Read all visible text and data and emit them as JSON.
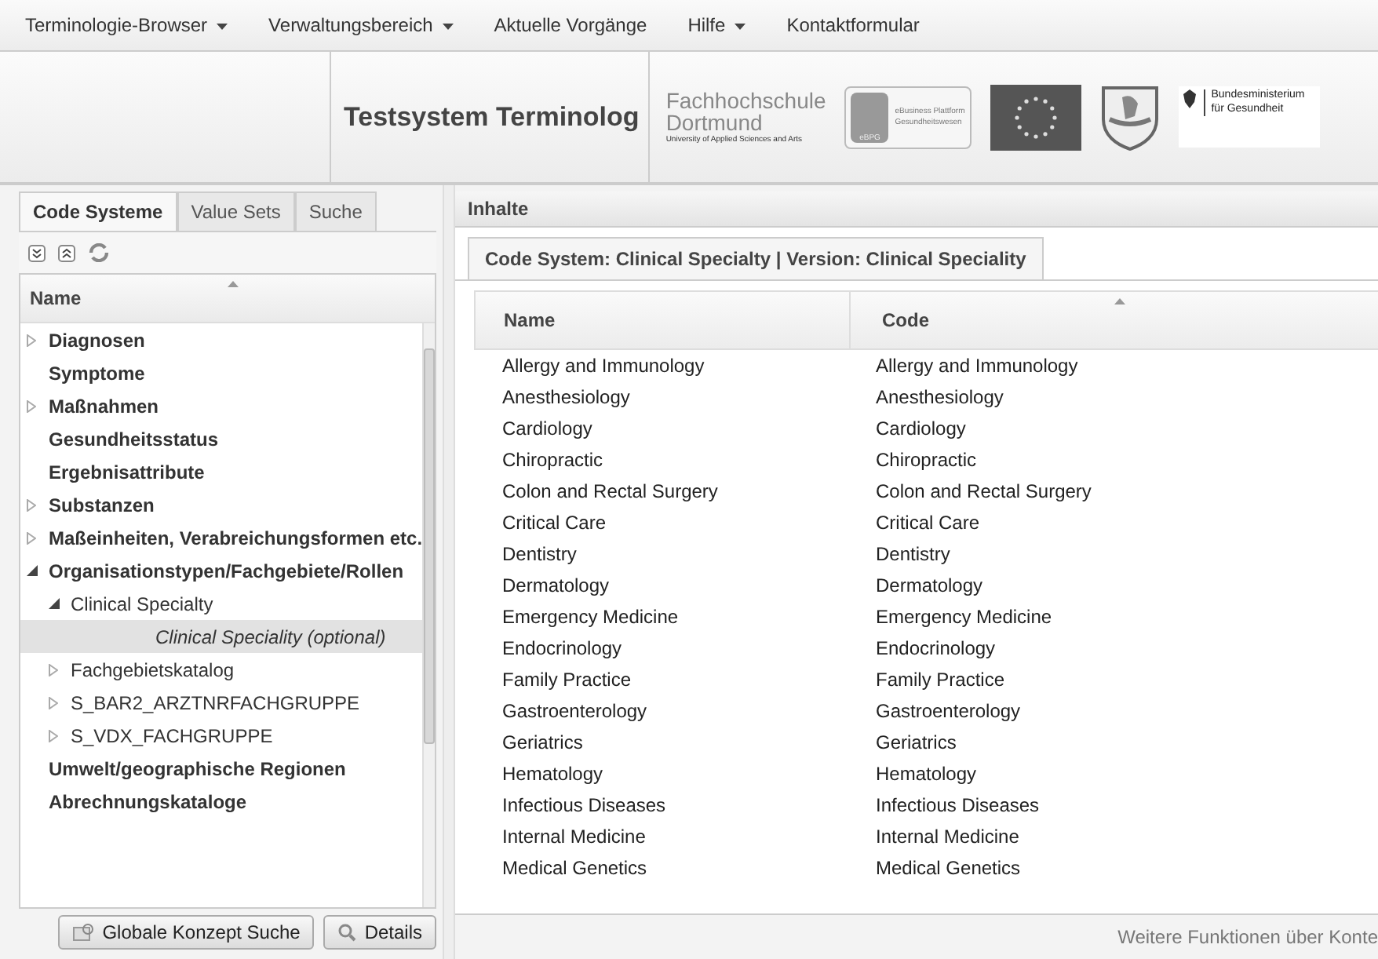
{
  "menu": [
    {
      "label": "Terminologie-Browser",
      "dropdown": true
    },
    {
      "label": "Verwaltungsbereich",
      "dropdown": true
    },
    {
      "label": "Aktuelle Vorgänge",
      "dropdown": false
    },
    {
      "label": "Hilfe",
      "dropdown": true
    },
    {
      "label": "Kontaktformular",
      "dropdown": false
    }
  ],
  "header": {
    "title": "Testsystem Terminolog",
    "fh_logo": [
      "Fachhochschule",
      "Dortmund",
      "University of Applied Sciences and Arts"
    ],
    "ebpg_logo": [
      "eBusiness Plattform",
      "Gesundheitswesen",
      "eBPG"
    ],
    "bmg_logo": [
      "Bundesministerium",
      "für Gesundheit"
    ]
  },
  "left_tabs": [
    {
      "label": "Code Systeme",
      "selected": true
    },
    {
      "label": "Value Sets",
      "selected": false
    },
    {
      "label": "Suche",
      "selected": false
    }
  ],
  "tree": {
    "column": "Name",
    "items": [
      {
        "label": "Diagnosen",
        "expanded": false,
        "selected": false
      },
      {
        "label": "Symptome",
        "selected": false
      },
      {
        "label": "Maßnahmen",
        "expanded": false,
        "selected": false
      },
      {
        "label": "Gesundheitsstatus",
        "selected": false
      },
      {
        "label": "Ergebnisattribute",
        "selected": false
      },
      {
        "label": "Substanzen",
        "expanded": false,
        "selected": false
      },
      {
        "label": "Maßeinheiten, Verabreichungsformen etc.",
        "expanded": false,
        "selected": false
      },
      {
        "label": "Organisationstypen/Fachgebiete/Rollen",
        "expanded": true,
        "selected": false,
        "children": [
          {
            "label": "Clinical Specialty",
            "expanded": true,
            "selected": false,
            "children": [
              {
                "label": "Clinical Speciality (optional)",
                "selected": true,
                "italic": true
              }
            ]
          },
          {
            "label": "Fachgebietskatalog",
            "expanded": false,
            "selected": false
          },
          {
            "label": "S_BAR2_ARZTNRFACHGRUPPE",
            "expanded": false,
            "selected": false
          },
          {
            "label": "S_VDX_FACHGRUPPE",
            "expanded": false,
            "selected": false
          }
        ]
      },
      {
        "label": "Umwelt/geographische Regionen",
        "selected": false
      },
      {
        "label": "Abrechnungskataloge",
        "selected": false
      }
    ]
  },
  "left_buttons": [
    "Globale Konzept Suche",
    "Details"
  ],
  "content": {
    "title": "Inhalte",
    "tab": "Code System: Clinical Specialty | Version: Clinical Speciality",
    "columns": [
      {
        "label": "Name",
        "sorted": false
      },
      {
        "label": "Code",
        "sorted": true
      }
    ],
    "rows": [
      [
        "Allergy and Immunology",
        "Allergy and Immunology"
      ],
      [
        "Anesthesiology",
        "Anesthesiology"
      ],
      [
        "Cardiology",
        "Cardiology"
      ],
      [
        "Chiropractic",
        "Chiropractic"
      ],
      [
        "Colon and Rectal Surgery",
        "Colon and Rectal Surgery"
      ],
      [
        "Critical Care",
        "Critical Care"
      ],
      [
        "Dentistry",
        "Dentistry"
      ],
      [
        "Dermatology",
        "Dermatology"
      ],
      [
        "Emergency Medicine",
        "Emergency Medicine"
      ],
      [
        "Endocrinology",
        "Endocrinology"
      ],
      [
        "Family Practice",
        "Family Practice"
      ],
      [
        "Gastroenterology",
        "Gastroenterology"
      ],
      [
        "Geriatrics",
        "Geriatrics"
      ],
      [
        "Hematology",
        "Hematology"
      ],
      [
        "Infectious Diseases",
        "Infectious Diseases"
      ],
      [
        "Internal Medicine",
        "Internal Medicine"
      ],
      [
        "Medical Genetics",
        "Medical Genetics"
      ]
    ],
    "footer": "Weitere Funktionen über Konte"
  }
}
